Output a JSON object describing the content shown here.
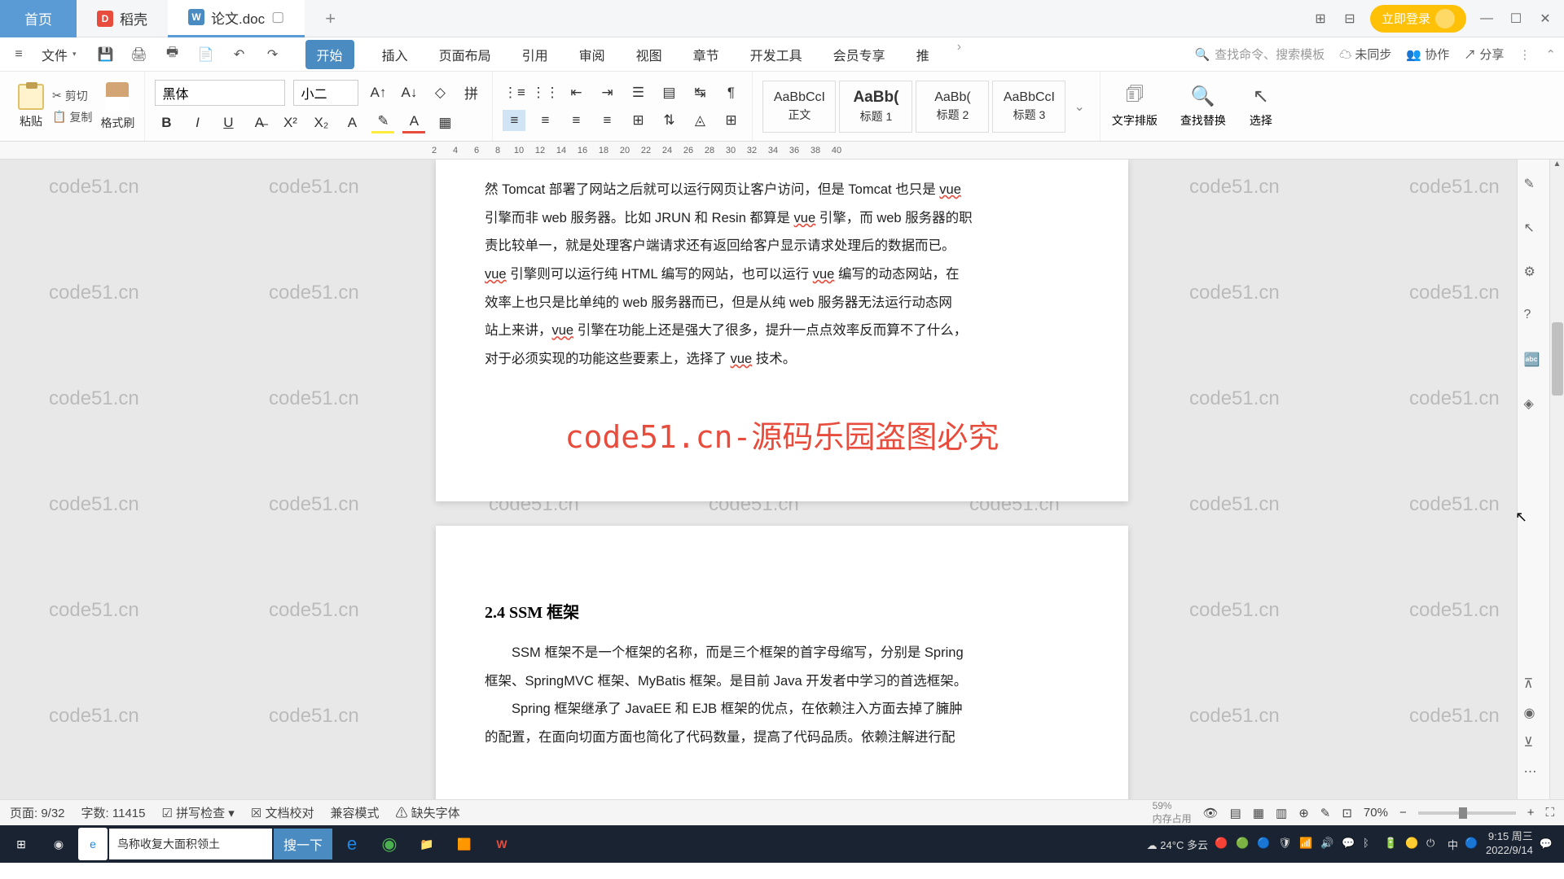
{
  "tabs": {
    "home": "首页",
    "docker": "稻壳",
    "doc": "论文.doc"
  },
  "title_right": {
    "login": "立即登录"
  },
  "menu": {
    "file": "文件",
    "tabs": [
      "开始",
      "插入",
      "页面布局",
      "引用",
      "审阅",
      "视图",
      "章节",
      "开发工具",
      "会员专享",
      "推"
    ],
    "search": "查找命令、搜索模板",
    "sync": "未同步",
    "collab": "协作",
    "share": "分享"
  },
  "clipboard": {
    "paste": "粘贴",
    "cut": "剪切",
    "copy": "复制",
    "brush": "格式刷"
  },
  "font": {
    "name": "黑体",
    "size": "小二"
  },
  "styles": [
    {
      "preview": "AaBbCcI",
      "name": "正文"
    },
    {
      "preview": "AaBb(",
      "name": "标题 1"
    },
    {
      "preview": "AaBb(",
      "name": "标题 2"
    },
    {
      "preview": "AaBbCcI",
      "name": "标题 3"
    }
  ],
  "ribbon_right": {
    "layout": "文字排版",
    "find": "查找替换",
    "select": "选择"
  },
  "ruler_marks": [
    "2",
    "4",
    "6",
    "8",
    "10",
    "12",
    "14",
    "16",
    "18",
    "20",
    "22",
    "24",
    "26",
    "28",
    "30",
    "32",
    "34",
    "36",
    "38",
    "40"
  ],
  "doc": {
    "p1_l1": "然 Tomcat 部署了网站之后就可以运行网页让客户访问，但是 Tomcat 也只是 ",
    "p1_vue": "vue",
    "p1_l2": "引擎而非 web 服务器。比如 JRUN 和 Resin 都算是 ",
    "p1_l2b": " 引擎，而 web 服务器的职",
    "p1_l3": "责比较单一，就是处理客户端请求还有返回给客户显示请求处理后的数据而已。",
    "p1_l4a": " 引擎则可以运行纯 HTML 编写的网站，也可以运行 ",
    "p1_l4b": " 编写的动态网站，在",
    "p1_l5": "效率上也只是比单纯的 web 服务器而已，但是从纯 web 服务器无法运行动态网",
    "p1_l6a": "站上来讲，",
    "p1_l6b": " 引擎在功能上还是强大了很多，提升一点点效率反而算不了什么，",
    "p1_l7a": "对于必须实现的功能这些要素上，选择了 ",
    "p1_l7b": " 技术。",
    "watermark": "code51.cn-源码乐园盗图必究",
    "h2": "2.4 SSM 框架",
    "p2_l1": "SSM 框架不是一个框架的名称，而是三个框架的首字母缩写，分别是 Spring",
    "p2_l2": "框架、SpringMVC 框架、MyBatis 框架。是目前 Java 开发者中学习的首选框架。",
    "p2_l3": "Spring 框架继承了 JavaEE 和 EJB 框架的优点，在依赖注入方面去掉了臃肿",
    "p2_l4": "的配置，在面向切面方面也简化了代码数量，提高了代码品质。依赖注解进行配"
  },
  "wm_text": "code51.cn",
  "status": {
    "page": "页面: 9/32",
    "words": "字数: 11415",
    "spell": "拼写检查",
    "proof": "文档校对",
    "compat": "兼容模式",
    "missing": "缺失字体",
    "zoom": "70%",
    "memory": "内存占用",
    "perf": "59%"
  },
  "taskbar": {
    "search": "鸟称收复大面积领土",
    "search_btn": "搜一下",
    "weather": "24°C 多云",
    "time": "9:15 周三",
    "date": "2022/9/14"
  }
}
